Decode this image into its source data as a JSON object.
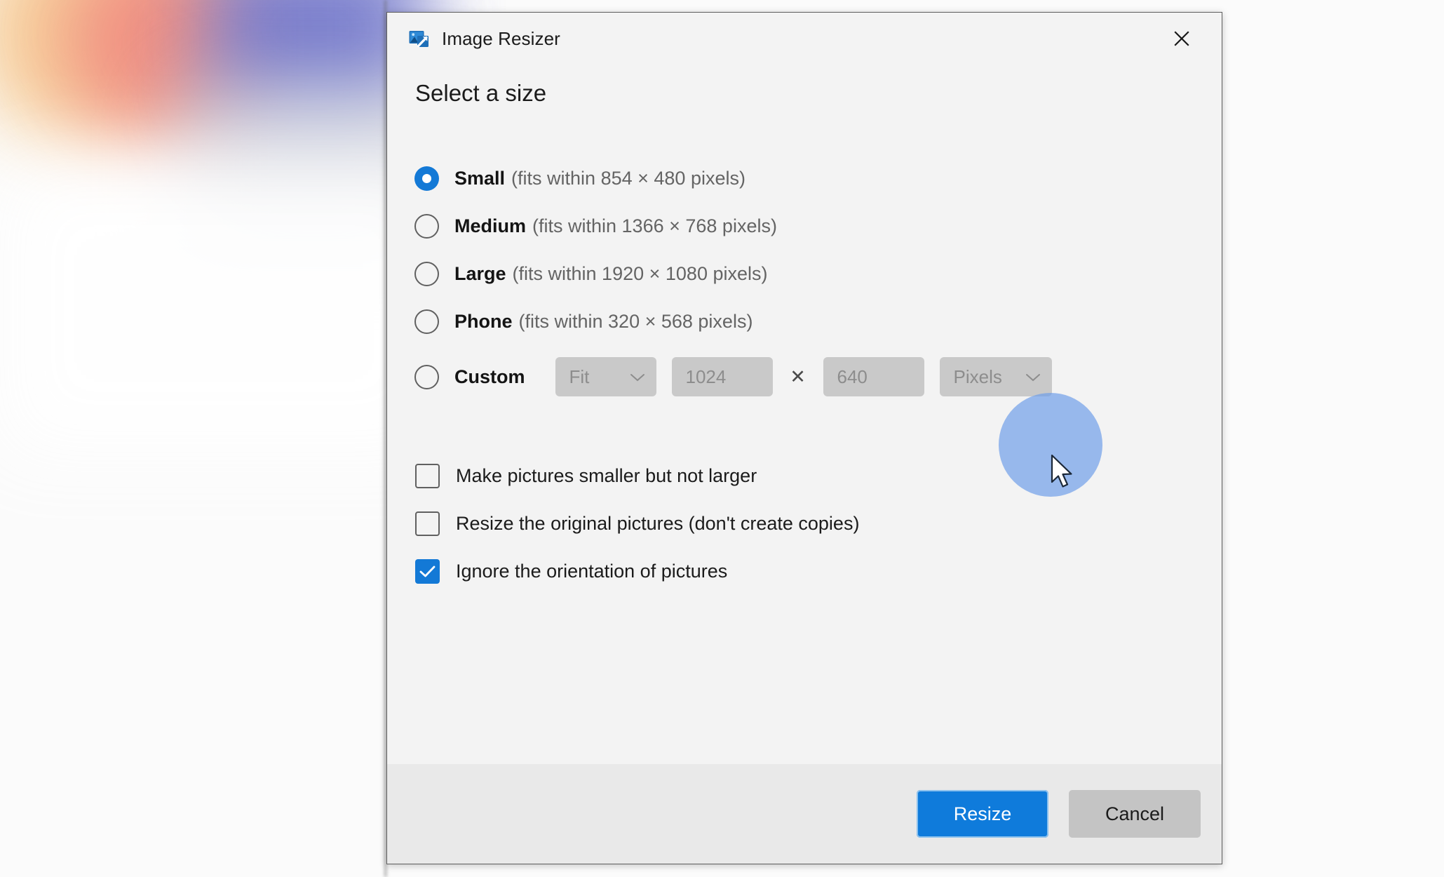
{
  "window": {
    "title": "Image Resizer",
    "app_icon": "image-resize-icon",
    "close_label": "×"
  },
  "main": {
    "heading": "Select a size",
    "size_options": [
      {
        "label": "Small",
        "hint": "(fits within 854 × 480 pixels)",
        "selected": true
      },
      {
        "label": "Medium",
        "hint": "(fits within 1366 × 768 pixels)",
        "selected": false
      },
      {
        "label": "Large",
        "hint": "(fits within 1920 × 1080 pixels)",
        "selected": false
      },
      {
        "label": "Phone",
        "hint": "(fits within 320 × 568 pixels)",
        "selected": false
      }
    ],
    "custom": {
      "label": "Custom",
      "selected": false,
      "fit_value": "Fit",
      "width_value": "1024",
      "separator": "✕",
      "height_value": "640",
      "unit_value": "Pixels",
      "disabled": true
    },
    "checkboxes": [
      {
        "label": "Make pictures smaller but not larger",
        "checked": false
      },
      {
        "label": "Resize the original pictures (don't create copies)",
        "checked": false
      },
      {
        "label": "Ignore the orientation of pictures",
        "checked": true
      }
    ]
  },
  "footer": {
    "primary_label": "Resize",
    "secondary_label": "Cancel"
  },
  "colors": {
    "accent": "#0f7bdb",
    "control_accent": "#1379d6",
    "dialog_bg": "#f3f3f3",
    "footer_bg": "#e9e9e9",
    "disabled_control": "#c9c9c9",
    "cancel_button": "#c4c4c4",
    "hint_text": "#646464",
    "ripple": "#6f9ee8"
  }
}
